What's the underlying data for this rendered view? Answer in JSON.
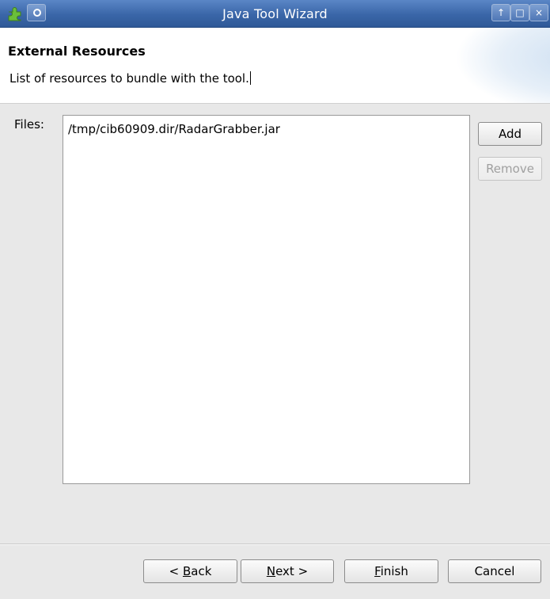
{
  "window": {
    "title": "Java Tool Wizard",
    "controls": {
      "minimize_glyph": "↑",
      "maximize_glyph": "□",
      "close_glyph": "×"
    }
  },
  "header": {
    "title": "External Resources",
    "description": "List of resources to bundle with the tool."
  },
  "files": {
    "label": "Files:",
    "items": [
      "/tmp/cib60909.dir/RadarGrabber.jar"
    ]
  },
  "side_buttons": {
    "add": "Add",
    "remove": "Remove"
  },
  "footer": {
    "back_prefix": "< ",
    "back_mnemonic": "B",
    "back_rest": "ack",
    "next_mnemonic": "N",
    "next_rest": "ext >",
    "finish_mnemonic": "F",
    "finish_rest": "inish",
    "cancel": "Cancel"
  }
}
